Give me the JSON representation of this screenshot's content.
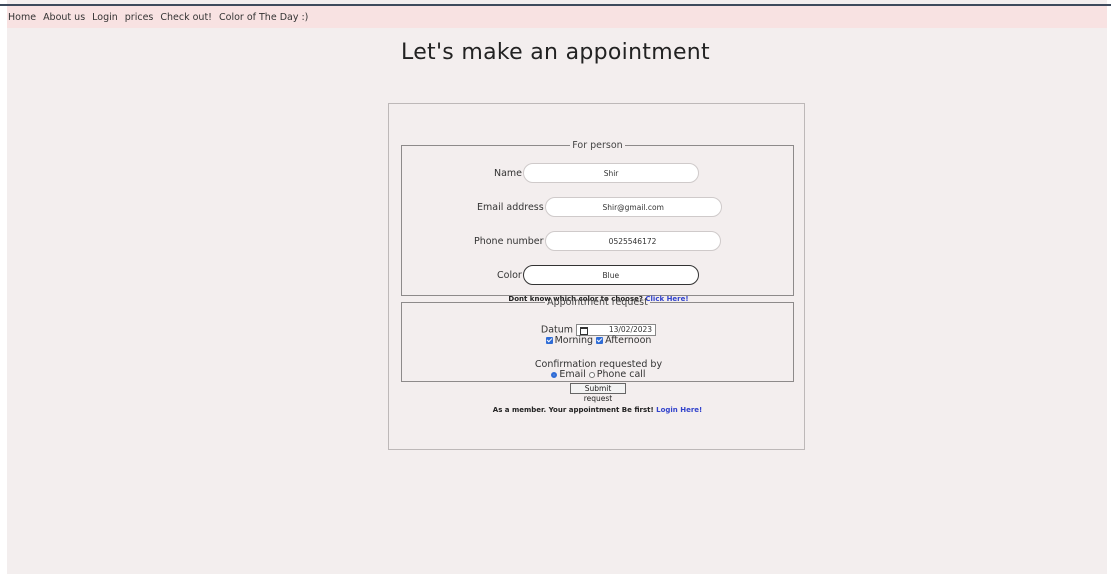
{
  "nav": {
    "items": [
      "Home",
      "About us",
      "Login",
      "prices",
      "Check out!",
      "Color of The Day :)"
    ]
  },
  "page": {
    "title": "Let's make an appointment"
  },
  "person": {
    "legend": "For person",
    "name_label": "Name",
    "name_value": "Shir",
    "email_label": "Email address",
    "email_value": "Shir@gmail.com",
    "phone_label": "Phone number",
    "phone_value": "0525546172",
    "color_label": "Color",
    "color_value": "Blue",
    "hint_text": "Dont know which color to choose?",
    "hint_link": "Click Here!"
  },
  "appointment": {
    "legend": "Appointment request",
    "date_label": "Datum",
    "date_value": "13/02/2023",
    "morning_label": "Morning",
    "afternoon_label": "Afternoon",
    "morning_checked": true,
    "afternoon_checked": true,
    "confirm_label": "Confirmation requested by",
    "email_option": "Email",
    "phone_option": "Phone call",
    "selected_option": "Email"
  },
  "submit_label": "Submit request",
  "member": {
    "text": "As a member. Your appointment Be first!",
    "link": "Login Here!"
  },
  "colors": {
    "nav_bg": "#f8e2e2",
    "page_bg": "#f3eeee",
    "link": "#3344cc",
    "check_blue": "#2f6cd6"
  }
}
